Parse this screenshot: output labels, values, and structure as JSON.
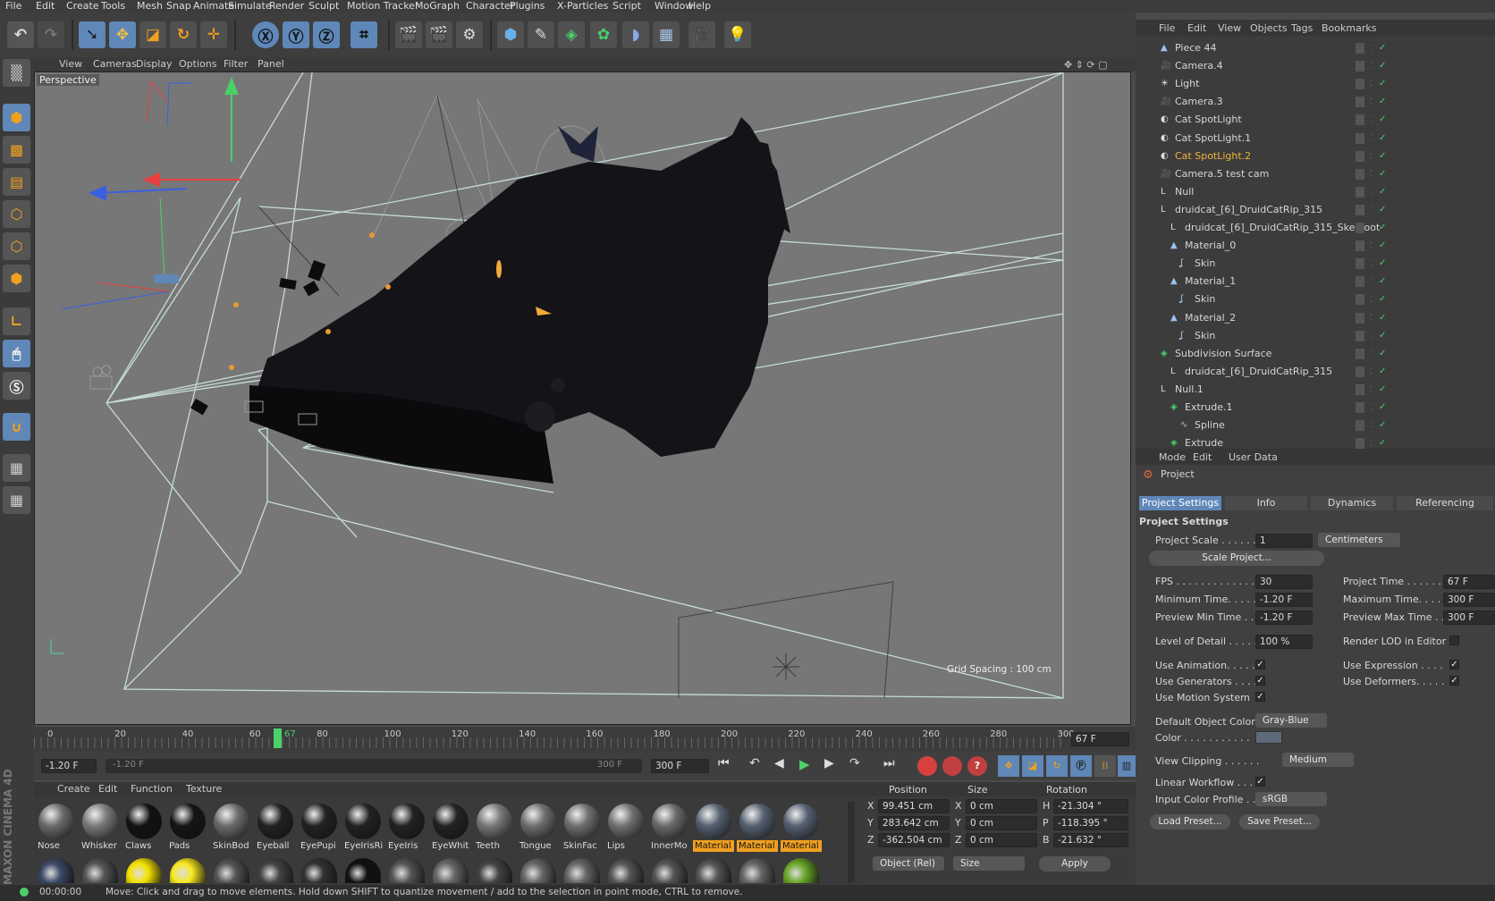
{
  "menubar": [
    "File",
    "Edit",
    "Create",
    "Tools",
    "Mesh",
    "Snap",
    "Animate",
    "Simulate",
    "Render",
    "Sculpt",
    "Motion Tracker",
    "MoGraph",
    "Character",
    "Plugins",
    "X-Particles",
    "Script",
    "Window",
    "Help"
  ],
  "viewport": {
    "menu": [
      "View",
      "Cameras",
      "Display",
      "Options",
      "Filter",
      "Panel"
    ],
    "label": "Perspective",
    "grid_spacing": "Grid Spacing : 100 cm"
  },
  "timeline": {
    "ticks": [
      "0",
      "20",
      "40",
      "60",
      "80",
      "100",
      "120",
      "140",
      "160",
      "180",
      "200",
      "220",
      "240",
      "260",
      "280",
      "300"
    ],
    "current_frame": "67",
    "frame_field": "67 F"
  },
  "transport": {
    "start": "-1.20 F",
    "range_start": "-1.20 F",
    "range_end": "300 F",
    "end": "300 F"
  },
  "material_manager": {
    "menu": [
      "Create",
      "Edit",
      "Function",
      "Texture"
    ],
    "materials": [
      {
        "name": "Nose",
        "color": "#6a6a6a"
      },
      {
        "name": "Whisker",
        "color": "#7a7a7a"
      },
      {
        "name": "Claws",
        "color": "#111111"
      },
      {
        "name": "Pads",
        "color": "#141414"
      },
      {
        "name": "SkinBod",
        "color": "#6b6b6b"
      },
      {
        "name": "Eyeball",
        "color": "#222222"
      },
      {
        "name": "EyePupi",
        "color": "#222222"
      },
      {
        "name": "EyeIrisRi",
        "color": "#222222"
      },
      {
        "name": "EyeIris",
        "color": "#222222"
      },
      {
        "name": "EyeWhit",
        "color": "#222222"
      },
      {
        "name": "Teeth",
        "color": "#777777"
      },
      {
        "name": "Tongue",
        "color": "#6e6e6e"
      },
      {
        "name": "SkinFac",
        "color": "#6e6e6e"
      },
      {
        "name": "Lips",
        "color": "#707070"
      },
      {
        "name": "InnerMo",
        "color": "#6a6a6a"
      },
      {
        "name": "Material",
        "color": "#556070",
        "selected": true
      },
      {
        "name": "Material",
        "color": "#556070",
        "selected": true
      },
      {
        "name": "Material",
        "color": "#556070",
        "selected": true
      }
    ],
    "row2_colors": [
      "#3c4a66",
      "#555555",
      "#f5e400",
      "#f8ea20",
      "#555555",
      "#444",
      "#333",
      "#111",
      "#555",
      "#666",
      "#444",
      "#666",
      "#666",
      "#555",
      "#555",
      "#555",
      "#666",
      "#6aa82a"
    ]
  },
  "coordinates": {
    "headers": [
      "Position",
      "Size",
      "Rotation"
    ],
    "rows": [
      {
        "axis": "X",
        "pos": "99.451 cm",
        "size_axis": "X",
        "size": "0 cm",
        "rot_axis": "H",
        "rot": "-21.304 °"
      },
      {
        "axis": "Y",
        "pos": "283.642 cm",
        "size_axis": "Y",
        "size": "0 cm",
        "rot_axis": "P",
        "rot": "-118.395 °"
      },
      {
        "axis": "Z",
        "pos": "-362.504 cm",
        "size_axis": "Z",
        "size": "0 cm",
        "rot_axis": "B",
        "rot": "-21.632 °"
      }
    ],
    "mode": "Object (Rel)",
    "size_mode": "Size",
    "apply": "Apply"
  },
  "object_manager": {
    "menu": [
      "File",
      "Edit",
      "View",
      "Objects",
      "Tags",
      "Bookmarks"
    ],
    "objects": [
      {
        "name": "Piece 44",
        "indent": 1,
        "icon": "polygon-icon"
      },
      {
        "name": "Camera.4",
        "indent": 1,
        "icon": "camera-icon"
      },
      {
        "name": "Light",
        "indent": 1,
        "icon": "light-icon"
      },
      {
        "name": "Camera.3",
        "indent": 1,
        "icon": "camera-icon"
      },
      {
        "name": "Cat SpotLight",
        "indent": 1,
        "icon": "spotlight-icon"
      },
      {
        "name": "Cat SpotLight.1",
        "indent": 1,
        "icon": "spotlight-icon"
      },
      {
        "name": "Cat SpotLight.2",
        "indent": 1,
        "icon": "spotlight-icon",
        "selected": true
      },
      {
        "name": "Camera.5 test cam",
        "indent": 1,
        "icon": "camera-icon"
      },
      {
        "name": "Null",
        "indent": 1,
        "icon": "null-icon"
      },
      {
        "name": "druidcat_[6]_DruidCatRip_315",
        "indent": 1,
        "icon": "null-icon"
      },
      {
        "name": "druidcat_[6]_DruidCatRip_315_SkelRoot",
        "indent": 2,
        "icon": "null-icon"
      },
      {
        "name": "Material_0",
        "indent": 2,
        "icon": "polygon-icon"
      },
      {
        "name": "Skin",
        "indent": 3,
        "icon": "skin-icon"
      },
      {
        "name": "Material_1",
        "indent": 2,
        "icon": "polygon-icon"
      },
      {
        "name": "Skin",
        "indent": 3,
        "icon": "skin-icon"
      },
      {
        "name": "Material_2",
        "indent": 2,
        "icon": "polygon-icon"
      },
      {
        "name": "Skin",
        "indent": 3,
        "icon": "skin-icon"
      },
      {
        "name": "Subdivision Surface",
        "indent": 1,
        "icon": "subdivision-icon"
      },
      {
        "name": "druidcat_[6]_DruidCatRip_315",
        "indent": 2,
        "icon": "null-icon"
      },
      {
        "name": "Null.1",
        "indent": 1,
        "icon": "null-icon"
      },
      {
        "name": "Extrude.1",
        "indent": 2,
        "icon": "extrude-icon"
      },
      {
        "name": "Spline",
        "indent": 3,
        "icon": "spline-icon"
      },
      {
        "name": "Extrude",
        "indent": 2,
        "icon": "extrude-icon"
      }
    ]
  },
  "attribute_manager": {
    "menu": [
      "Mode",
      "Edit",
      "User Data"
    ],
    "title": "Project",
    "tabs": [
      "Project Settings",
      "Info",
      "Dynamics",
      "Referencing"
    ],
    "section": "Project Settings",
    "project_scale_label": "Project Scale . . . . . .",
    "project_scale": "1",
    "project_scale_unit": "Centimeters",
    "scale_project_btn": "Scale Project...",
    "fps_label": "FPS . . . . . . . . . . . . . .",
    "fps": "30",
    "project_time_label": "Project Time . . . . . . . .",
    "project_time": "67 F",
    "min_time_label": "Minimum Time. . . . .",
    "min_time": "-1.20 F",
    "max_time_label": "Maximum Time. . . . .",
    "max_time": "300 F",
    "preview_min_label": "Preview Min Time . . .",
    "preview_min": "-1.20 F",
    "preview_max_label": "Preview Max Time . . .",
    "preview_max": "300 F",
    "lod_label": "Level of Detail . . . . .",
    "lod": "100 %",
    "render_lod_label": "Render LOD in Editor",
    "use_animation_label": "Use Animation. . . . .",
    "use_expression_label": "Use Expression . . . .",
    "use_generators_label": "Use Generators . . . .",
    "use_deformers_label": "Use Deformers. . . . .",
    "use_motion_label": "Use Motion System",
    "default_color_label": "Default Object Color",
    "default_color": "Gray-Blue",
    "color_label": "Color . . . . . . . . . . .",
    "view_clipping_label": "View Clipping . . . . . .",
    "view_clipping": "Medium",
    "linear_workflow_label": "Linear Workflow . . . .",
    "input_profile_label": "Input Color Profile . .",
    "input_profile": "sRGB",
    "load_preset": "Load Preset...",
    "save_preset": "Save Preset..."
  },
  "status": {
    "time": "00:00:00",
    "message": "Move: Click and drag to move elements. Hold down SHIFT to quantize movement / add to the selection in point mode, CTRL to remove."
  },
  "branding": "MAXON CINEMA 4D",
  "colors": {
    "accent": "#5f87b8",
    "selected_text": "#f2b33a",
    "timeline_marker": "#4cd06a"
  }
}
